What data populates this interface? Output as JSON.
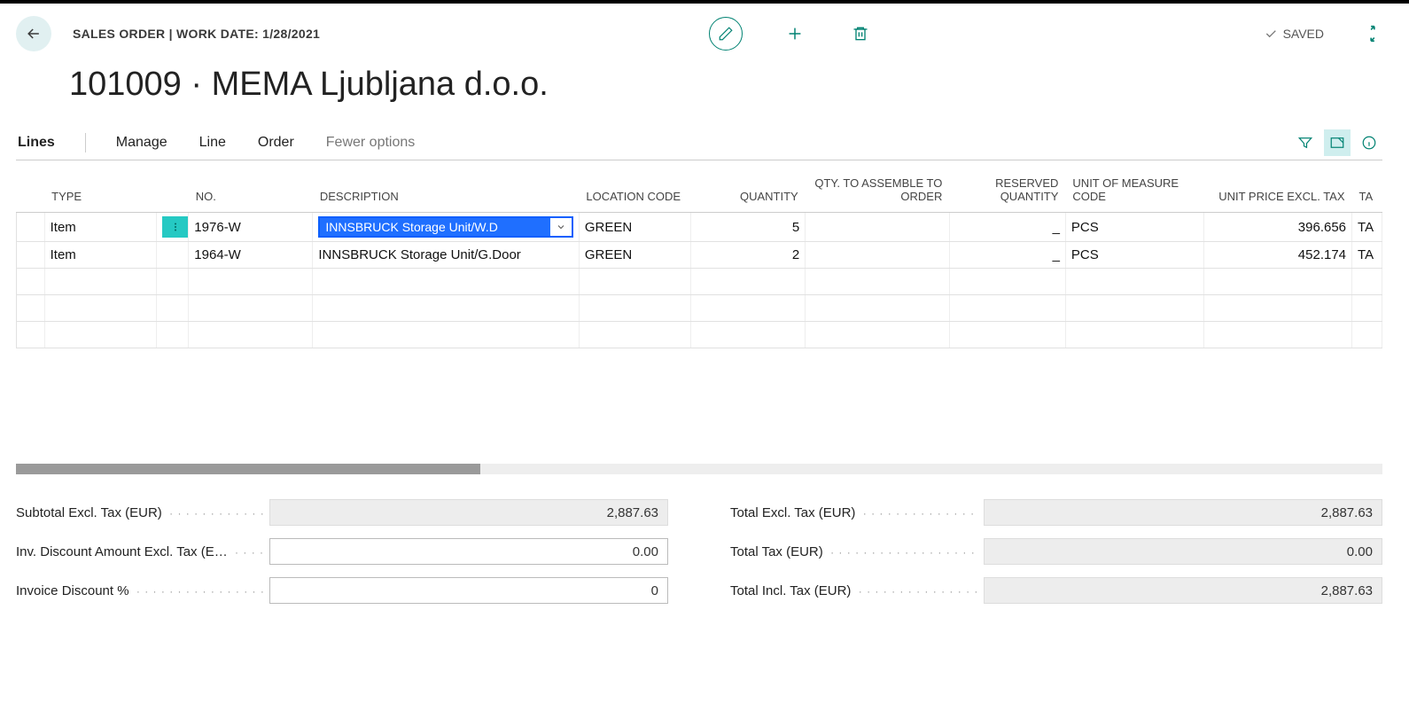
{
  "header": {
    "breadcrumb": "SALES ORDER | WORK DATE: 1/28/2021",
    "saved_label": "SAVED",
    "title": "101009 · MEMA Ljubljana d.o.o."
  },
  "tabs": {
    "lines": "Lines",
    "manage": "Manage",
    "line": "Line",
    "order": "Order",
    "fewer": "Fewer options"
  },
  "columns": {
    "type": "TYPE",
    "no": "NO.",
    "description": "DESCRIPTION",
    "location": "LOCATION CODE",
    "quantity": "QUANTITY",
    "qty_assemble": "QTY. TO ASSEMBLE TO ORDER",
    "reserved": "RESERVED QUANTITY",
    "uom": "UNIT OF MEASURE CODE",
    "unit_price": "UNIT PRICE EXCL. TAX",
    "tax": "TA"
  },
  "rows": [
    {
      "type": "Item",
      "no": "1976-W",
      "description": "INNSBRUCK Storage Unit/W.D",
      "location": "GREEN",
      "quantity": "5",
      "assemble": "",
      "reserved": "_",
      "uom": "PCS",
      "unit_price": "396.656",
      "tax": "TA"
    },
    {
      "type": "Item",
      "no": "1964-W",
      "description": "INNSBRUCK Storage Unit/G.Door",
      "location": "GREEN",
      "quantity": "2",
      "assemble": "",
      "reserved": "_",
      "uom": "PCS",
      "unit_price": "452.174",
      "tax": "TA"
    }
  ],
  "totals": {
    "left": {
      "subtotal_label": "Subtotal Excl. Tax (EUR)",
      "subtotal_value": "2,887.63",
      "inv_disc_amt_label": "Inv. Discount Amount Excl. Tax (E…",
      "inv_disc_amt_value": "0.00",
      "inv_disc_pct_label": "Invoice Discount %",
      "inv_disc_pct_value": "0"
    },
    "right": {
      "total_excl_label": "Total Excl. Tax (EUR)",
      "total_excl_value": "2,887.63",
      "total_tax_label": "Total Tax (EUR)",
      "total_tax_value": "0.00",
      "total_incl_label": "Total Incl. Tax (EUR)",
      "total_incl_value": "2,887.63"
    }
  }
}
